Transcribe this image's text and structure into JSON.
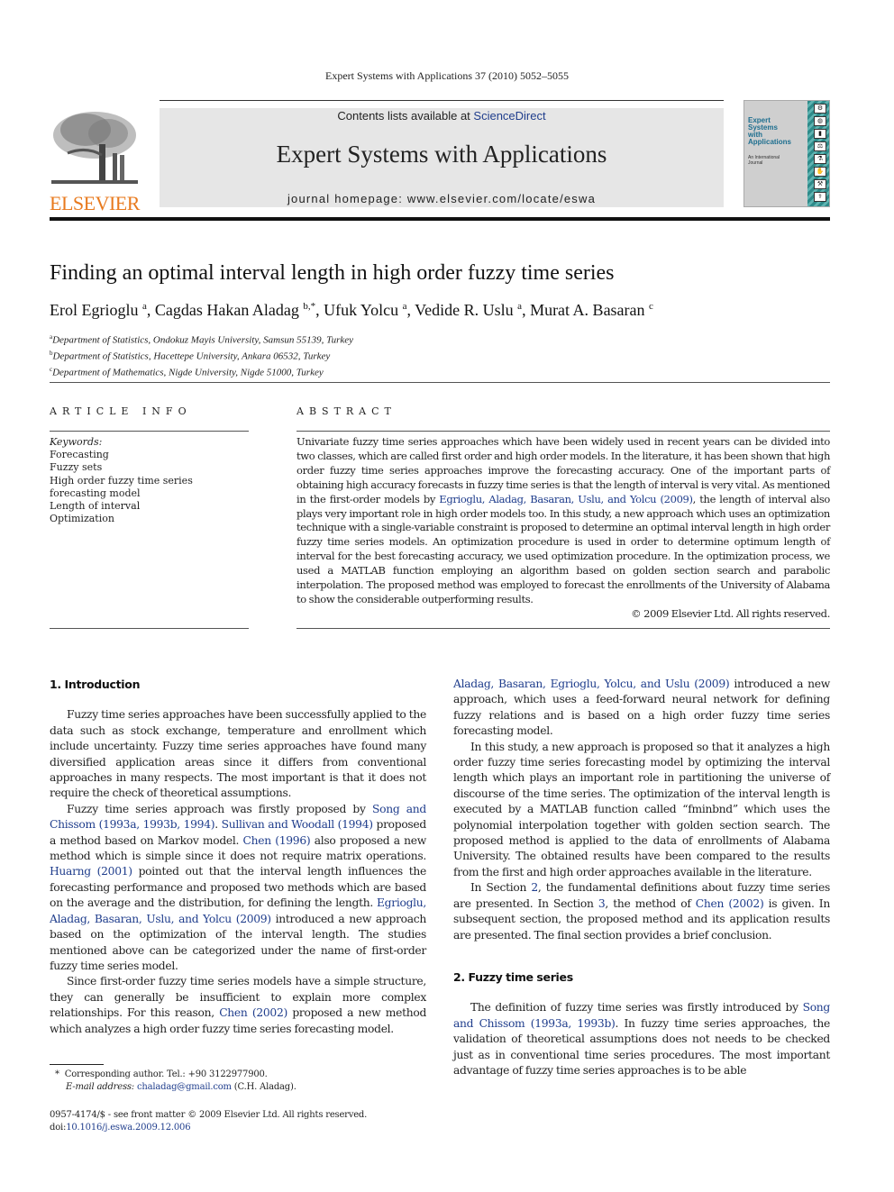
{
  "running_head": "Expert Systems with Applications 37 (2010) 5052–5055",
  "masthead": {
    "publisher_logo_text": "ELSEVIER",
    "contents_prefix": "Contents lists available at ",
    "contents_link": "ScienceDirect",
    "journal_title": "Expert Systems with Applications",
    "homepage_text": "journal homepage: www.elsevier.com/locate/eswa",
    "cover": {
      "title_lines": [
        "Expert",
        "Systems",
        "with",
        "Applications"
      ],
      "subtitle_lines": [
        "An International",
        "Journal"
      ],
      "accent_color": "#2e8a89",
      "title_color": "#1d6e8f"
    },
    "colors": {
      "elsevier_orange": "#e87a1e",
      "link_blue": "#1f3d8c",
      "banner_gray": "#e6e6e6"
    }
  },
  "article": {
    "title": "Finding an optimal interval length in high order fuzzy time series",
    "authors": [
      {
        "name": "Erol Egrioglu",
        "sup": "a",
        "sep": ", "
      },
      {
        "name": "Cagdas Hakan Aladag",
        "sup": "b,*",
        "sep": ", "
      },
      {
        "name": "Ufuk Yolcu",
        "sup": "a",
        "sep": ", "
      },
      {
        "name": "Vedide R. Uslu",
        "sup": "a",
        "sep": ", "
      },
      {
        "name": "Murat A. Basaran",
        "sup": "c",
        "sep": ""
      }
    ],
    "affiliations": [
      {
        "sup": "a",
        "text": "Department of Statistics, Ondokuz Mayis University, Samsun 55139, Turkey"
      },
      {
        "sup": "b",
        "text": "Department of Statistics, Hacettepe University, Ankara 06532, Turkey"
      },
      {
        "sup": "c",
        "text": "Department of Mathematics, Nigde University, Nigde 51000, Turkey"
      }
    ]
  },
  "article_info": {
    "label": "ARTICLE INFO",
    "keywords_label": "Keywords:",
    "keywords": [
      "Forecasting",
      "Fuzzy sets",
      "High order fuzzy time series forecasting model",
      "Length of interval",
      "Optimization"
    ]
  },
  "abstract": {
    "label": "ABSTRACT",
    "text_1": "Univariate fuzzy time series approaches which have been widely used in recent years can be divided into two classes, which are called first order and high order models. In the literature, it has been shown that high order fuzzy time series approaches improve the forecasting accuracy. One of the important parts of obtaining high accuracy forecasts in fuzzy time series is that the length of interval is very vital. As mentioned in the first-order models by ",
    "ref_1": "Egrioglu, Aladag, Basaran, Uslu, and Yolcu (2009)",
    "text_2": ", the length of interval also plays very important role in high order models too. In this study, a new approach which uses an optimization technique with a single-variable constraint is proposed to determine an optimal interval length in high order fuzzy time series models. An optimization procedure is used in order to determine optimum length of interval for the best forecasting accuracy, we used optimization procedure. In the optimization process, we used a MATLAB function employing an algorithm based on golden section search and parabolic interpolation. The proposed method was employed to forecast the enrollments of the University of Alabama to show the considerable outperforming results.",
    "copyright": "© 2009 Elsevier Ltd. All rights reserved."
  },
  "body": {
    "section1_heading": "1. Introduction",
    "p1": "Fuzzy time series approaches have been successfully applied to the data such as stock exchange, temperature and enrollment which include uncertainty. Fuzzy time series approaches have found many diversified application areas since it differs from conventional approaches in many respects. The most important is that it does not require the check of theoretical assumptions.",
    "p2": {
      "t1": "Fuzzy time series approach was firstly proposed by ",
      "r1": "Song and Chissom (1993a, 1993b, 1994)",
      "t2": ". ",
      "r2": "Sullivan and Woodall (1994)",
      "t3": " proposed a method based on Markov model. ",
      "r3": "Chen (1996)",
      "t4": " also proposed a new method which is simple since it does not require matrix operations. ",
      "r4": "Huarng (2001)",
      "t5": " pointed out that the interval length influences the forecasting performance and proposed two methods which are based on the average and the distribution, for defining the length. ",
      "r5": "Egrioglu, Aladag, Basaran, Uslu, and Yolcu (2009)",
      "t6": " introduced a new approach based on the optimization of the interval length. The studies mentioned above can be categorized under the name of first-order fuzzy time series model."
    },
    "p3": {
      "t1": "Since first-order fuzzy time series models have a simple structure, they can generally be insufficient to explain more complex relationships. For this reason, ",
      "r1": "Chen (2002)",
      "t2": " proposed a new method which analyzes a high order fuzzy time series forecasting model."
    },
    "p3_cont": {
      "r1": "Aladag, Basaran, Egrioglu, Yolcu, and Uslu (2009)",
      "t1": " introduced a new approach, which uses a feed-forward neural network for defining fuzzy relations and is based on a high order fuzzy time series forecasting model."
    },
    "p4": "In this study, a new approach is proposed so that it analyzes a high order fuzzy time series forecasting model by optimizing the interval length which plays an important role in partitioning the universe of discourse of the time series. The optimization of the interval length is executed by a MATLAB function called “fminbnd” which uses the polynomial interpolation together with golden section search. The proposed method is applied to the data of enrollments of Alabama University. The obtained results have been compared to the results from the first and high order approaches available in the literature.",
    "p5": {
      "t1": "In Section ",
      "r1": "2",
      "t2": ", the fundamental definitions about fuzzy time series are presented. In Section ",
      "r2": "3",
      "t3": ", the method of ",
      "r3": "Chen (2002)",
      "t4": " is given. In subsequent section, the proposed method and its application results are presented. The final section provides a brief conclusion."
    },
    "section2_heading": "2. Fuzzy time series",
    "p6": {
      "t1": "The definition of fuzzy time series was firstly introduced by ",
      "r1": "Song and Chissom (1993a, 1993b)",
      "t2": ". In fuzzy time series approaches, the validation of theoretical assumptions does not needs to be checked just as in conventional time series procedures. The most important advantage of fuzzy time series approaches is to be able"
    }
  },
  "footnote": {
    "marker": "*",
    "line1": "Corresponding author. Tel.: +90 3122977900.",
    "email_label": "E-mail address:",
    "email": "chaladag@gmail.com",
    "email_suffix": " (C.H. Aladag)."
  },
  "imprint": {
    "line1": "0957-4174/$ - see front matter © 2009 Elsevier Ltd. All rights reserved.",
    "doi_label": "doi:",
    "doi": "10.1016/j.eswa.2009.12.006"
  }
}
